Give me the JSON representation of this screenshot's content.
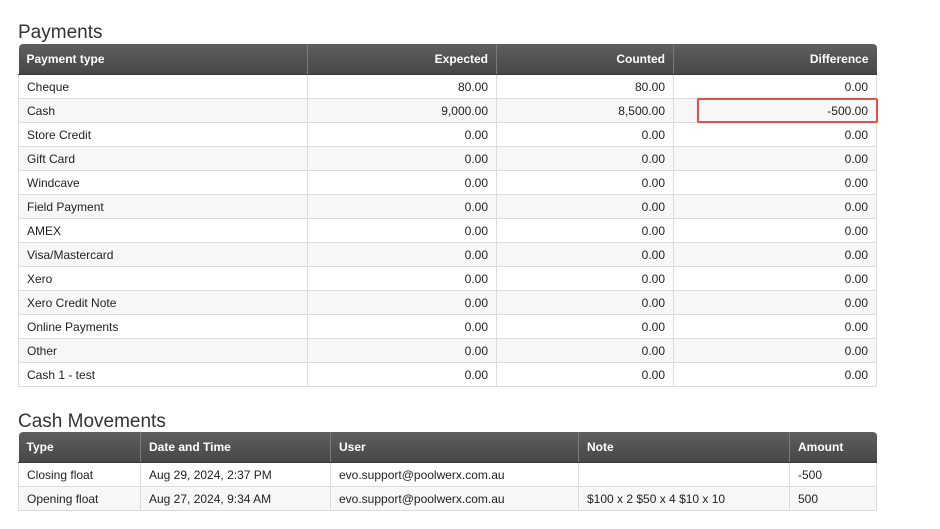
{
  "payments": {
    "title": "Payments",
    "headers": [
      "Payment type",
      "Expected",
      "Counted",
      "Difference"
    ],
    "rows": [
      [
        "Cheque",
        "80.00",
        "80.00",
        "0.00"
      ],
      [
        "Cash",
        "9,000.00",
        "8,500.00",
        "-500.00"
      ],
      [
        "Store Credit",
        "0.00",
        "0.00",
        "0.00"
      ],
      [
        "Gift Card",
        "0.00",
        "0.00",
        "0.00"
      ],
      [
        "Windcave",
        "0.00",
        "0.00",
        "0.00"
      ],
      [
        "Field Payment",
        "0.00",
        "0.00",
        "0.00"
      ],
      [
        "AMEX",
        "0.00",
        "0.00",
        "0.00"
      ],
      [
        "Visa/Mastercard",
        "0.00",
        "0.00",
        "0.00"
      ],
      [
        "Xero",
        "0.00",
        "0.00",
        "0.00"
      ],
      [
        "Xero Credit Note",
        "0.00",
        "0.00",
        "0.00"
      ],
      [
        "Online Payments",
        "0.00",
        "0.00",
        "0.00"
      ],
      [
        "Other",
        "0.00",
        "0.00",
        "0.00"
      ],
      [
        "Cash 1 - test",
        "0.00",
        "0.00",
        "0.00"
      ]
    ],
    "highlight_color": "#d9534f"
  },
  "cash_movements": {
    "title": "Cash Movements",
    "headers": [
      "Type",
      "Date and Time",
      "User",
      "Note",
      "Amount"
    ],
    "rows": [
      [
        "Closing float",
        "Aug 29, 2024, 2:37 PM",
        "evo.support@poolwerx.com.au",
        "",
        "-500"
      ],
      [
        "Opening float",
        "Aug 27, 2024, 9:34 AM",
        "evo.support@poolwerx.com.au",
        "$100 x 2 $50 x 4 $10 x 10",
        "500"
      ]
    ]
  }
}
